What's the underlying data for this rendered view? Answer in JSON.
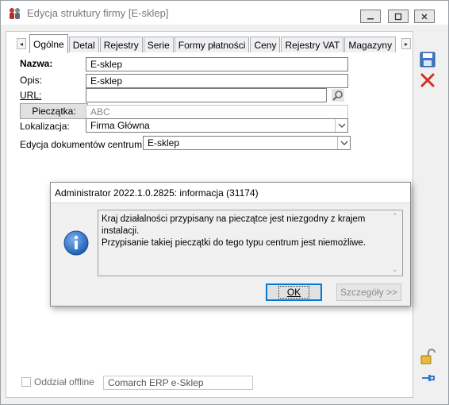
{
  "window": {
    "title": "Edycja struktury firmy [E-sklep]",
    "accent_color": "#0078d7",
    "app_icon": "people-icon"
  },
  "tabs": [
    {
      "label": "Ogólne",
      "active": true
    },
    {
      "label": "Detal"
    },
    {
      "label": "Rejestry"
    },
    {
      "label": "Serie"
    },
    {
      "label": "Formy płatności"
    },
    {
      "label": "Ceny"
    },
    {
      "label": "Rejestry VAT"
    },
    {
      "label": "Magazyny"
    }
  ],
  "form": {
    "nazwa_label": "Nazwa:",
    "nazwa_value": "E-sklep",
    "opis_label": "Opis:",
    "opis_value": "E-sklep",
    "url_label": "URL:",
    "url_value": "",
    "pieczatka_button": "Pieczątka:",
    "pieczatka_value": "ABC",
    "lokalizacja_label": "Lokalizacja:",
    "lokalizacja_value": "Firma Główna",
    "edycja_label": "Edycja dokumentów centrum:",
    "edycja_value": "E-sklep",
    "oddzial_label": "Oddział offline",
    "oddzial_checked": false,
    "footer_value": "Comarch ERP e-Sklep"
  },
  "side_buttons": {
    "save_icon": "save-icon",
    "cancel_icon": "cancel-icon",
    "lock_icon": "unlock-icon",
    "pin_icon": "pin-icon"
  },
  "dialog": {
    "title": "Administrator 2022.1.0.2825: informacja (31174)",
    "message_line1": "Kraj działalności przypisany na pieczątce jest niezgodny z krajem instalacji.",
    "message_line2": "Przypisanie takiej pieczątki do tego typu centrum jest niemożliwe.",
    "ok_label": "OK",
    "details_label": "Szczegóły >>",
    "icon": "info-icon"
  }
}
